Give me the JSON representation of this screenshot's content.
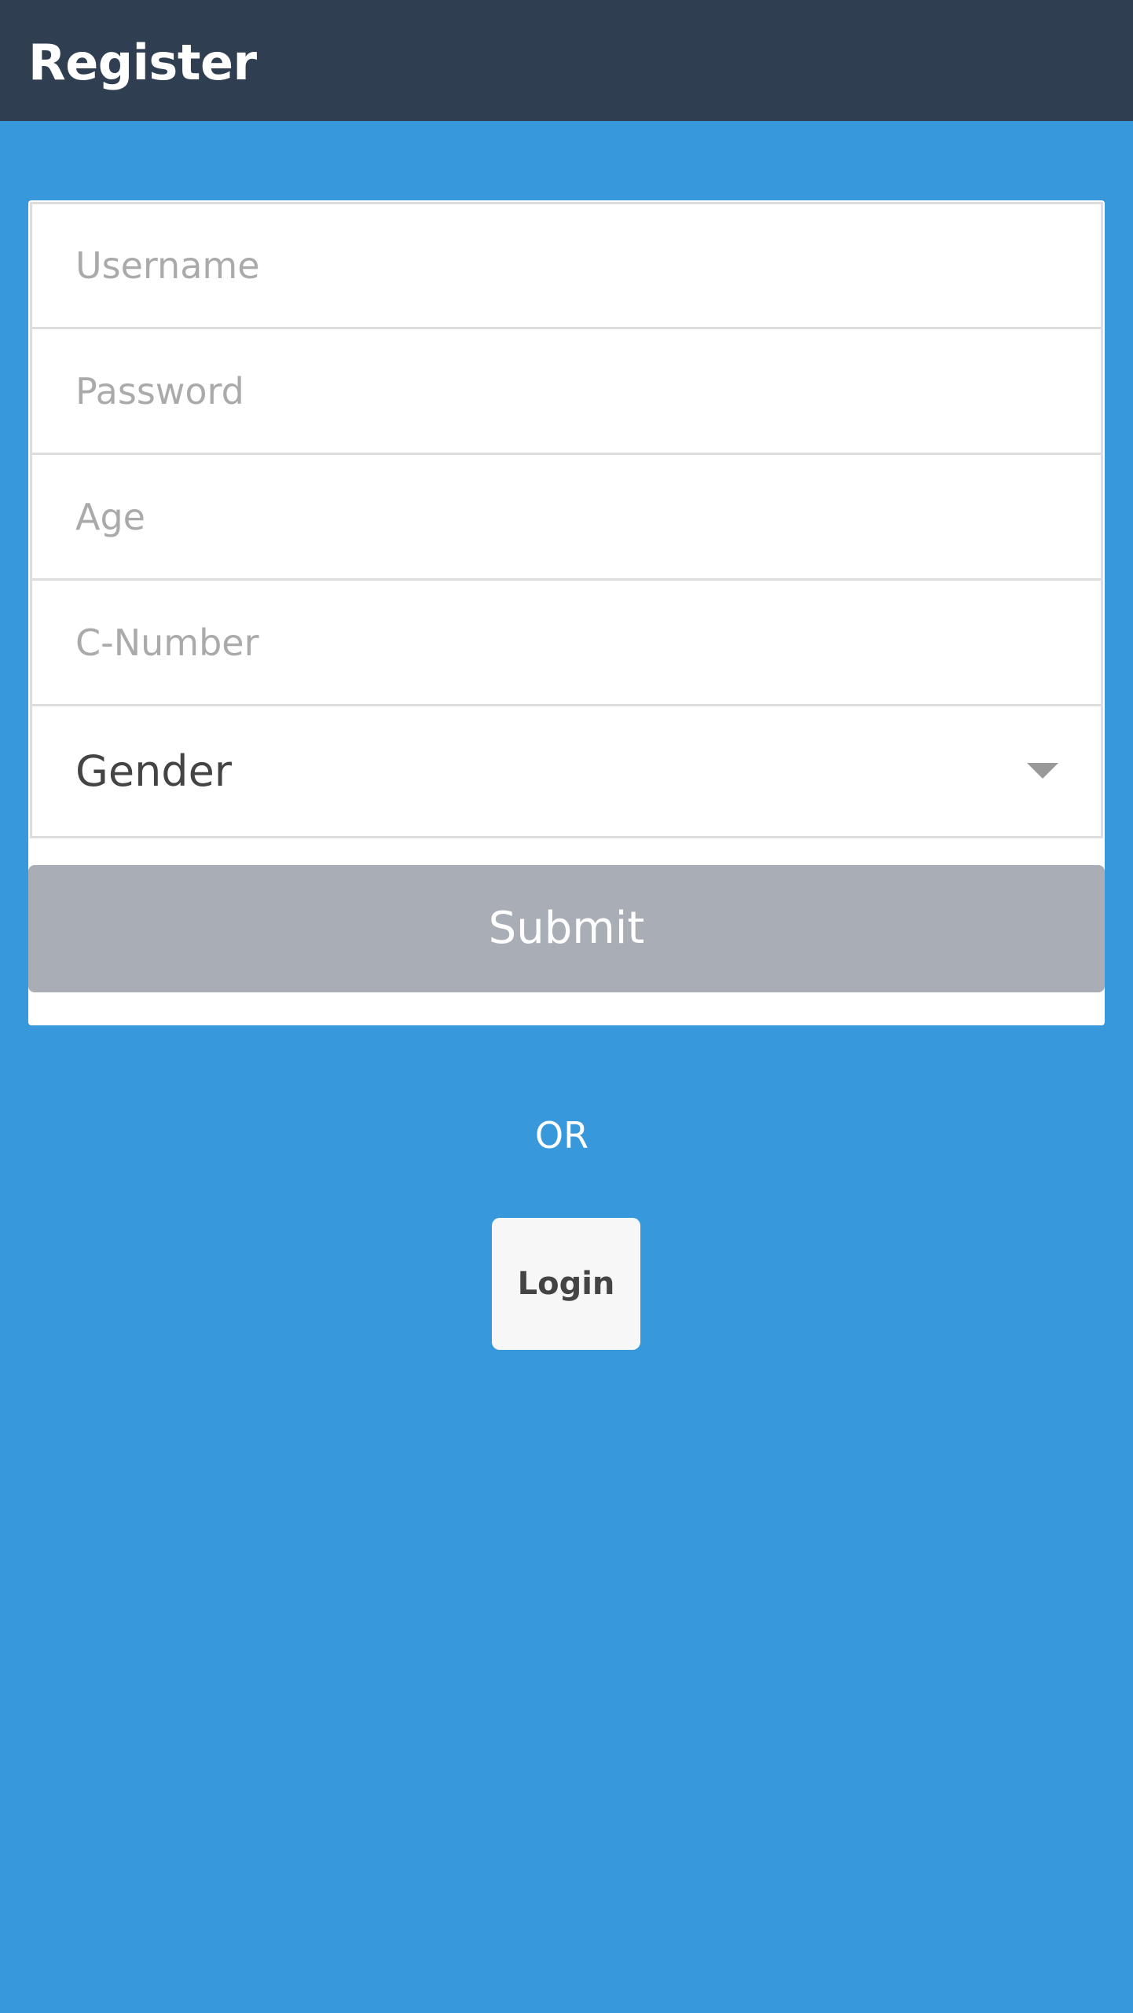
{
  "header": {
    "title": "Register"
  },
  "form": {
    "username": {
      "placeholder": "Username",
      "value": ""
    },
    "password": {
      "placeholder": "Password",
      "value": ""
    },
    "age": {
      "placeholder": "Age",
      "value": ""
    },
    "c_number": {
      "placeholder": "C-Number",
      "value": ""
    },
    "gender": {
      "selected": "Gender",
      "icon": "chevron-down-icon"
    },
    "submit_label": "Submit"
  },
  "divider_text": "OR",
  "login_label": "Login",
  "colors": {
    "header_bg": "#2f3e50",
    "page_bg": "#3799db",
    "submit_bg": "#a9aeb6",
    "login_bg": "#f7f7f7"
  }
}
